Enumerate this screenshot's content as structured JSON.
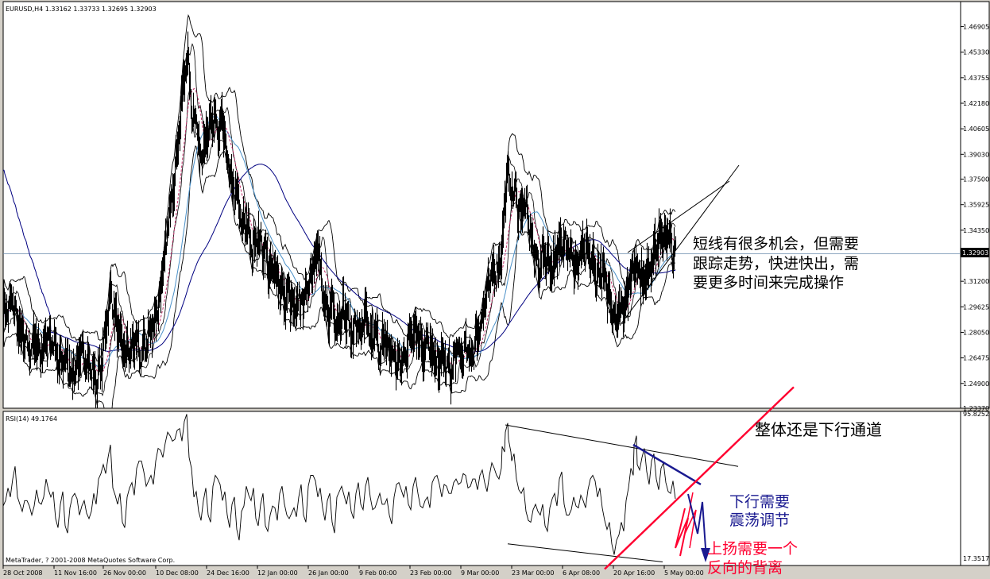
{
  "chart_data": [
    {
      "type": "line",
      "title": "EURUSD,H4  1.33162 1.33733 1.32695 1.32903",
      "current_price_label": "1.32903",
      "y_ticks": [
        "1.46905",
        "1.45330",
        "1.43755",
        "1.42180",
        "1.40605",
        "1.39030",
        "1.37500",
        "1.35925",
        "1.34350",
        "1.31200",
        "1.29625",
        "1.28050",
        "1.26475",
        "1.24900",
        "1.23370"
      ],
      "y_tick_values": [
        1.46905,
        1.4533,
        1.43755,
        1.4218,
        1.40605,
        1.3903,
        1.375,
        1.35925,
        1.3435,
        1.312,
        1.29625,
        1.2805,
        1.26475,
        1.249,
        1.2337
      ],
      "ylim": [
        1.2337,
        1.4845
      ],
      "x_ticks": [
        "28 Oct 2008",
        "11 Nov 16:00",
        "26 Nov 00:00",
        "10 Dec 08:00",
        "24 Dec 16:00",
        "12 Jan 00:00",
        "26 Jan 00:00",
        "9 Feb 00:00",
        "23 Feb 00:00",
        "9 Mar 00:00",
        "23 Mar 00:00",
        "6 Apr 08:00",
        "20 Apr 16:00",
        "5 May 00:00"
      ],
      "price_path": [
        [
          0,
          1.291
        ],
        [
          6,
          1.295
        ],
        [
          12,
          1.3
        ],
        [
          18,
          1.285
        ],
        [
          25,
          1.275
        ],
        [
          32,
          1.27
        ],
        [
          40,
          1.275
        ],
        [
          48,
          1.268
        ],
        [
          56,
          1.28
        ],
        [
          64,
          1.272
        ],
        [
          70,
          1.26
        ],
        [
          78,
          1.265
        ],
        [
          86,
          1.255
        ],
        [
          94,
          1.262
        ],
        [
          102,
          1.268
        ],
        [
          110,
          1.258
        ],
        [
          118,
          1.25
        ],
        [
          124,
          1.262
        ],
        [
          130,
          1.29
        ],
        [
          136,
          1.305
        ],
        [
          142,
          1.285
        ],
        [
          150,
          1.27
        ],
        [
          158,
          1.268
        ],
        [
          166,
          1.275
        ],
        [
          172,
          1.265
        ],
        [
          180,
          1.275
        ],
        [
          188,
          1.285
        ],
        [
          196,
          1.3
        ],
        [
          204,
          1.33
        ],
        [
          210,
          1.36
        ],
        [
          216,
          1.38
        ],
        [
          222,
          1.41
        ],
        [
          226,
          1.43
        ],
        [
          230,
          1.45
        ],
        [
          234,
          1.44
        ],
        [
          238,
          1.41
        ],
        [
          242,
          1.42
        ],
        [
          246,
          1.39
        ],
        [
          250,
          1.395
        ],
        [
          256,
          1.4
        ],
        [
          260,
          1.405
        ],
        [
          266,
          1.415
        ],
        [
          270,
          1.4
        ],
        [
          276,
          1.41
        ],
        [
          282,
          1.385
        ],
        [
          288,
          1.37
        ],
        [
          294,
          1.365
        ],
        [
          300,
          1.345
        ],
        [
          306,
          1.35
        ],
        [
          312,
          1.33
        ],
        [
          318,
          1.34
        ],
        [
          324,
          1.335
        ],
        [
          330,
          1.33
        ],
        [
          336,
          1.315
        ],
        [
          342,
          1.32
        ],
        [
          348,
          1.31
        ],
        [
          354,
          1.3
        ],
        [
          360,
          1.305
        ],
        [
          366,
          1.29
        ],
        [
          372,
          1.3
        ],
        [
          378,
          1.3
        ],
        [
          384,
          1.31
        ],
        [
          390,
          1.325
        ],
        [
          396,
          1.335
        ],
        [
          402,
          1.3
        ],
        [
          408,
          1.29
        ],
        [
          414,
          1.3
        ],
        [
          420,
          1.285
        ],
        [
          426,
          1.295
        ],
        [
          432,
          1.29
        ],
        [
          438,
          1.28
        ],
        [
          444,
          1.285
        ],
        [
          450,
          1.28
        ],
        [
          456,
          1.29
        ],
        [
          462,
          1.275
        ],
        [
          468,
          1.28
        ],
        [
          474,
          1.27
        ],
        [
          480,
          1.275
        ],
        [
          486,
          1.27
        ],
        [
          492,
          1.265
        ],
        [
          498,
          1.26
        ],
        [
          504,
          1.265
        ],
        [
          510,
          1.275
        ],
        [
          516,
          1.285
        ],
        [
          522,
          1.28
        ],
        [
          528,
          1.27
        ],
        [
          534,
          1.275
        ],
        [
          540,
          1.265
        ],
        [
          546,
          1.26
        ],
        [
          552,
          1.265
        ],
        [
          558,
          1.26
        ],
        [
          564,
          1.255
        ],
        [
          570,
          1.27
        ],
        [
          576,
          1.265
        ],
        [
          582,
          1.27
        ],
        [
          588,
          1.265
        ],
        [
          594,
          1.275
        ],
        [
          600,
          1.285
        ],
        [
          606,
          1.3
        ],
        [
          612,
          1.31
        ],
        [
          618,
          1.32
        ],
        [
          624,
          1.32
        ],
        [
          630,
          1.35
        ],
        [
          634,
          1.38
        ],
        [
          638,
          1.37
        ],
        [
          644,
          1.365
        ],
        [
          650,
          1.355
        ],
        [
          656,
          1.36
        ],
        [
          662,
          1.345
        ],
        [
          668,
          1.33
        ],
        [
          674,
          1.32
        ],
        [
          680,
          1.33
        ],
        [
          686,
          1.325
        ],
        [
          692,
          1.32
        ],
        [
          698,
          1.33
        ],
        [
          704,
          1.34
        ],
        [
          710,
          1.335
        ],
        [
          716,
          1.325
        ],
        [
          722,
          1.32
        ],
        [
          728,
          1.33
        ],
        [
          734,
          1.33
        ],
        [
          740,
          1.325
        ],
        [
          746,
          1.315
        ],
        [
          752,
          1.32
        ],
        [
          758,
          1.31
        ],
        [
          764,
          1.3
        ],
        [
          770,
          1.29
        ],
        [
          776,
          1.295
        ],
        [
          782,
          1.3
        ],
        [
          788,
          1.31
        ],
        [
          794,
          1.325
        ],
        [
          800,
          1.32
        ],
        [
          806,
          1.31
        ],
        [
          812,
          1.32
        ],
        [
          818,
          1.33
        ],
        [
          824,
          1.335
        ],
        [
          830,
          1.34
        ],
        [
          836,
          1.342
        ],
        [
          842,
          1.33
        ],
        [
          846,
          1.329
        ]
      ],
      "guideline_label": ""
    },
    {
      "type": "line",
      "title": "RSI(14) 49.1764",
      "y_ticks": [
        "95.8252",
        "17.3517"
      ],
      "y_tick_values": [
        95.8252,
        17.3517
      ],
      "ylim": [
        12.0,
        97.5
      ],
      "rsi_path": [
        [
          0,
          45
        ],
        [
          6,
          55
        ],
        [
          12,
          60
        ],
        [
          18,
          50
        ],
        [
          24,
          42
        ],
        [
          30,
          48
        ],
        [
          36,
          40
        ],
        [
          42,
          54
        ],
        [
          48,
          46
        ],
        [
          54,
          60
        ],
        [
          60,
          50
        ],
        [
          66,
          38
        ],
        [
          72,
          46
        ],
        [
          78,
          34
        ],
        [
          84,
          44
        ],
        [
          90,
          52
        ],
        [
          96,
          40
        ],
        [
          102,
          48
        ],
        [
          108,
          38
        ],
        [
          114,
          52
        ],
        [
          120,
          60
        ],
        [
          126,
          68
        ],
        [
          132,
          72
        ],
        [
          138,
          55
        ],
        [
          144,
          46
        ],
        [
          150,
          36
        ],
        [
          156,
          50
        ],
        [
          162,
          58
        ],
        [
          168,
          66
        ],
        [
          174,
          70
        ],
        [
          180,
          56
        ],
        [
          186,
          62
        ],
        [
          192,
          70
        ],
        [
          198,
          76
        ],
        [
          204,
          80
        ],
        [
          210,
          84
        ],
        [
          216,
          82
        ],
        [
          222,
          88
        ],
        [
          228,
          92
        ],
        [
          234,
          72
        ],
        [
          240,
          50
        ],
        [
          246,
          42
        ],
        [
          252,
          48
        ],
        [
          258,
          40
        ],
        [
          264,
          56
        ],
        [
          270,
          60
        ],
        [
          276,
          48
        ],
        [
          282,
          40
        ],
        [
          288,
          46
        ],
        [
          294,
          32
        ],
        [
          300,
          42
        ],
        [
          306,
          56
        ],
        [
          312,
          48
        ],
        [
          318,
          38
        ],
        [
          324,
          46
        ],
        [
          330,
          34
        ],
        [
          336,
          40
        ],
        [
          342,
          44
        ],
        [
          348,
          52
        ],
        [
          354,
          46
        ],
        [
          360,
          38
        ],
        [
          366,
          44
        ],
        [
          372,
          50
        ],
        [
          378,
          40
        ],
        [
          384,
          56
        ],
        [
          390,
          62
        ],
        [
          396,
          50
        ],
        [
          402,
          44
        ],
        [
          408,
          48
        ],
        [
          414,
          36
        ],
        [
          420,
          50
        ],
        [
          426,
          56
        ],
        [
          432,
          46
        ],
        [
          438,
          42
        ],
        [
          444,
          52
        ],
        [
          450,
          46
        ],
        [
          456,
          56
        ],
        [
          462,
          50
        ],
        [
          468,
          44
        ],
        [
          474,
          52
        ],
        [
          480,
          46
        ],
        [
          486,
          40
        ],
        [
          492,
          50
        ],
        [
          498,
          58
        ],
        [
          504,
          50
        ],
        [
          510,
          46
        ],
        [
          516,
          56
        ],
        [
          522,
          52
        ],
        [
          528,
          44
        ],
        [
          534,
          50
        ],
        [
          540,
          58
        ],
        [
          546,
          62
        ],
        [
          552,
          50
        ],
        [
          558,
          56
        ],
        [
          564,
          52
        ],
        [
          570,
          60
        ],
        [
          576,
          58
        ],
        [
          582,
          62
        ],
        [
          588,
          56
        ],
        [
          594,
          60
        ],
        [
          600,
          62
        ],
        [
          606,
          58
        ],
        [
          612,
          62
        ],
        [
          618,
          66
        ],
        [
          624,
          60
        ],
        [
          628,
          78
        ],
        [
          632,
          86
        ],
        [
          636,
          82
        ],
        [
          640,
          70
        ],
        [
          646,
          60
        ],
        [
          652,
          52
        ],
        [
          658,
          42
        ],
        [
          664,
          36
        ],
        [
          670,
          46
        ],
        [
          676,
          40
        ],
        [
          682,
          34
        ],
        [
          688,
          44
        ],
        [
          694,
          52
        ],
        [
          700,
          60
        ],
        [
          706,
          46
        ],
        [
          712,
          40
        ],
        [
          718,
          50
        ],
        [
          724,
          44
        ],
        [
          730,
          48
        ],
        [
          736,
          54
        ],
        [
          742,
          62
        ],
        [
          748,
          50
        ],
        [
          754,
          44
        ],
        [
          760,
          32
        ],
        [
          766,
          24
        ],
        [
          772,
          26
        ],
        [
          778,
          36
        ],
        [
          784,
          48
        ],
        [
          790,
          66
        ],
        [
          794,
          78
        ],
        [
          798,
          68
        ],
        [
          804,
          72
        ],
        [
          810,
          64
        ],
        [
          816,
          70
        ],
        [
          822,
          60
        ],
        [
          828,
          66
        ],
        [
          834,
          58
        ],
        [
          840,
          52
        ],
        [
          846,
          49
        ]
      ],
      "channel_upper": [
        [
          632,
          90
        ],
        [
          925,
          67
        ]
      ],
      "channel_lower": [
        [
          635,
          24
        ],
        [
          830,
          14
        ]
      ],
      "blue_trend": [
        [
          793,
          79
        ],
        [
          878,
          57
        ]
      ],
      "red_trend": [
        [
          757,
          10
        ],
        [
          995,
          111
        ]
      ]
    }
  ],
  "annotations": {
    "top_line1": "短线有很多机会，但需要",
    "top_line2": "跟踪走势，快进快出，需",
    "top_line3": "要更多时间来完成操作",
    "channel_text": "整体还是下行通道",
    "down_line1": "下行需要",
    "down_line2": "震荡调节",
    "up_line1": "上扬需要一个",
    "up_line2": "反向的背离"
  },
  "footer": "MetaTrader, ? 2001-2008 MetaQuotes Software Corp.",
  "colors": {
    "background": "#ffffff",
    "price": "#000000",
    "ma_blue": "#000080",
    "ma_lightblue": "#4a90c8",
    "ma_pink": "#c0306a",
    "red_line": "#ff0030",
    "navy_line": "#1a1a90"
  }
}
